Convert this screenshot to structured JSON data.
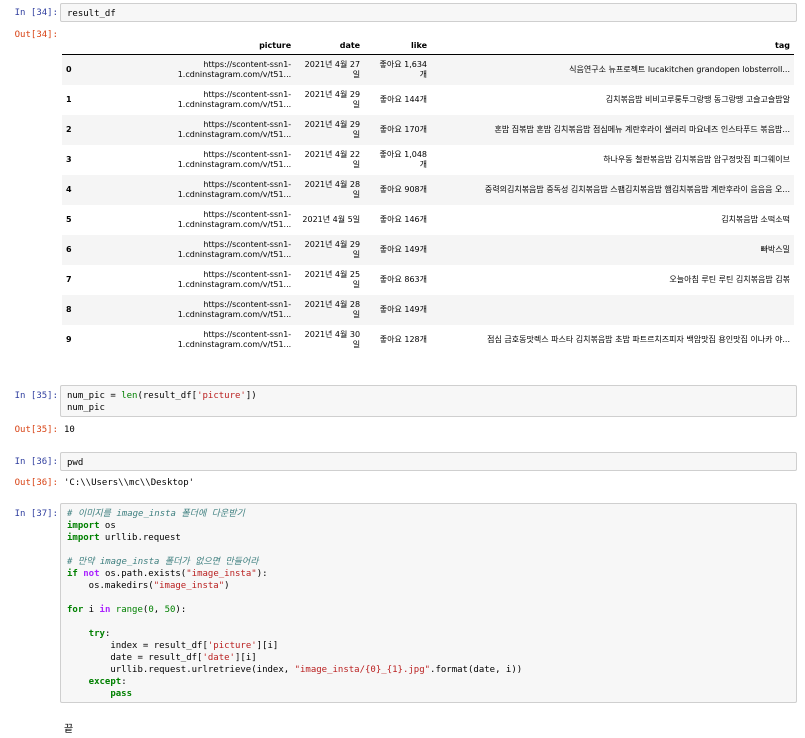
{
  "cells": {
    "c34": {
      "in_prompt": "In [34]:",
      "out_prompt": "Out[34]:",
      "code": "result_df",
      "table": {
        "columns": [
          "",
          "picture",
          "date",
          "like",
          "tag"
        ],
        "rows": [
          {
            "idx": "0",
            "picture_a": "https://scontent-ssn1-",
            "picture_b": "1.cdninstagram.com/v/t51...",
            "date_a": "2021년 4월 27",
            "date_b": "일",
            "like_a": "좋아요 1,634",
            "like_b": "개",
            "tag": "식음연구소 뉴프로젝트 lucakitchen grandopen lobsterroll..."
          },
          {
            "idx": "1",
            "picture_a": "https://scontent-ssn1-",
            "picture_b": "1.cdninstagram.com/v/t51...",
            "date_a": "2021년 4월 29",
            "date_b": "일",
            "like_a": "좋아요 144개",
            "like_b": "",
            "tag": "김치볶음밥 비비고루룽투그랑땡 동그랑땡 고슬고슬밥알"
          },
          {
            "idx": "2",
            "picture_a": "https://scontent-ssn1-",
            "picture_b": "1.cdninstagram.com/v/t51...",
            "date_a": "2021년 4월 29",
            "date_b": "일",
            "like_a": "좋아요 170개",
            "like_b": "",
            "tag": "혼밥 집볶밥 혼밥 김치볶음밥 점심메뉴 계란후라이 샐러리 마요네즈 인스타푸드 볶음밥..."
          },
          {
            "idx": "3",
            "picture_a": "https://scontent-ssn1-",
            "picture_b": "1.cdninstagram.com/v/t51...",
            "date_a": "2021년 4월 22",
            "date_b": "일",
            "like_a": "좋아요 1,048",
            "like_b": "개",
            "tag": "하나우동 철판볶음밥 김치볶음밥 압구정맛집 피그웨이브"
          },
          {
            "idx": "4",
            "picture_a": "https://scontent-ssn1-",
            "picture_b": "1.cdninstagram.com/v/t51...",
            "date_a": "2021년 4월 28",
            "date_b": "일",
            "like_a": "좋아요 908개",
            "like_b": "",
            "tag": "중력의김치볶음밥 중독성 김치볶음밥 스팸김치볶음밥 햄김치볶음밥 계란후라이 음음음 오..."
          },
          {
            "idx": "5",
            "picture_a": "https://scontent-ssn1-",
            "picture_b": "1.cdninstagram.com/v/t51...",
            "date_a": "2021년 4월 5일",
            "date_b": "",
            "like_a": "좋아요 146개",
            "like_b": "",
            "tag": "김치볶음밥 소떡소떡"
          },
          {
            "idx": "6",
            "picture_a": "https://scontent-ssn1-",
            "picture_b": "1.cdninstagram.com/v/t51...",
            "date_a": "2021년 4월 29",
            "date_b": "일",
            "like_a": "좋아요 149개",
            "like_b": "",
            "tag": "빠박스밀"
          },
          {
            "idx": "7",
            "picture_a": "https://scontent-ssn1-",
            "picture_b": "1.cdninstagram.com/v/t51...",
            "date_a": "2021년 4월 25",
            "date_b": "일",
            "like_a": "좋아요 863개",
            "like_b": "",
            "tag": "오늘아침 루틴 루틴 김치볶음밥 김볶"
          },
          {
            "idx": "8",
            "picture_a": "https://scontent-ssn1-",
            "picture_b": "1.cdninstagram.com/v/t51...",
            "date_a": "2021년 4월 28",
            "date_b": "일",
            "like_a": "좋아요 149개",
            "like_b": "",
            "tag": ""
          },
          {
            "idx": "9",
            "picture_a": "https://scontent-ssn1-",
            "picture_b": "1.cdninstagram.com/v/t51...",
            "date_a": "2021년 4월 30",
            "date_b": "일",
            "like_a": "좋아요 128개",
            "like_b": "",
            "tag": "점심 금호동맛렉스 파스타 김치볶음밥 초밥 파트르치즈피자 백암맛집 용인맛집 이나카 야..."
          }
        ]
      }
    },
    "c35": {
      "in_prompt": "In [35]:",
      "out_prompt": "Out[35]:",
      "code_l1_a": "num_pic = ",
      "code_l1_b": "len",
      "code_l1_c": "(result_df[",
      "code_l1_d": "'picture'",
      "code_l1_e": "])",
      "code_l2": "num_pic",
      "output": "10"
    },
    "c36": {
      "in_prompt": "In [36]:",
      "out_prompt": "Out[36]:",
      "code": "pwd",
      "output": "'C:\\\\Users\\\\mc\\\\Desktop'"
    },
    "c37": {
      "in_prompt": "In [37]:",
      "lines": {
        "l1": "# 이미지를 image_insta 폴더에 다운받기",
        "l2_kw": "import",
        "l2_rest": " os",
        "l3_kw": "import",
        "l3_rest": " urllib.request",
        "l4": "# 만약 image_insta 폴더가 없으면 만들어라",
        "l5_kw": "if",
        "l5_not": " not",
        "l5_a": " os.path.exists(",
        "l5_str": "\"image_insta\"",
        "l5_b": "):",
        "l6_a": "    os.makedirs(",
        "l6_str": "\"image_insta\"",
        "l6_b": ")",
        "l7_kw": "for",
        "l7_a": " i ",
        "l7_in": "in",
        "l7_b": " ",
        "l7_range": "range",
        "l7_c": "(",
        "l7_n0": "0",
        "l7_d": ", ",
        "l7_n1": "50",
        "l7_e": "):",
        "l8_kw": "    try",
        "l8_b": ":",
        "l9_a": "        index = result_df[",
        "l9_str": "'picture'",
        "l9_b": "][i]",
        "l10_a": "        date = result_df[",
        "l10_str": "'date'",
        "l10_b": "][i]",
        "l11_a": "        urllib.request.urlretrieve(index, ",
        "l11_str": "\"image_insta/{0}_{1}.jpg\"",
        "l11_b": ".format(date, i))",
        "l12_kw": "    except",
        "l12_b": ":",
        "l13_kw": "        pass"
      }
    }
  },
  "footer_text": "끝",
  "colors": {
    "in_prompt": "#303f9f",
    "out_prompt": "#d84315",
    "cell_bg": "#f7f7f7"
  }
}
